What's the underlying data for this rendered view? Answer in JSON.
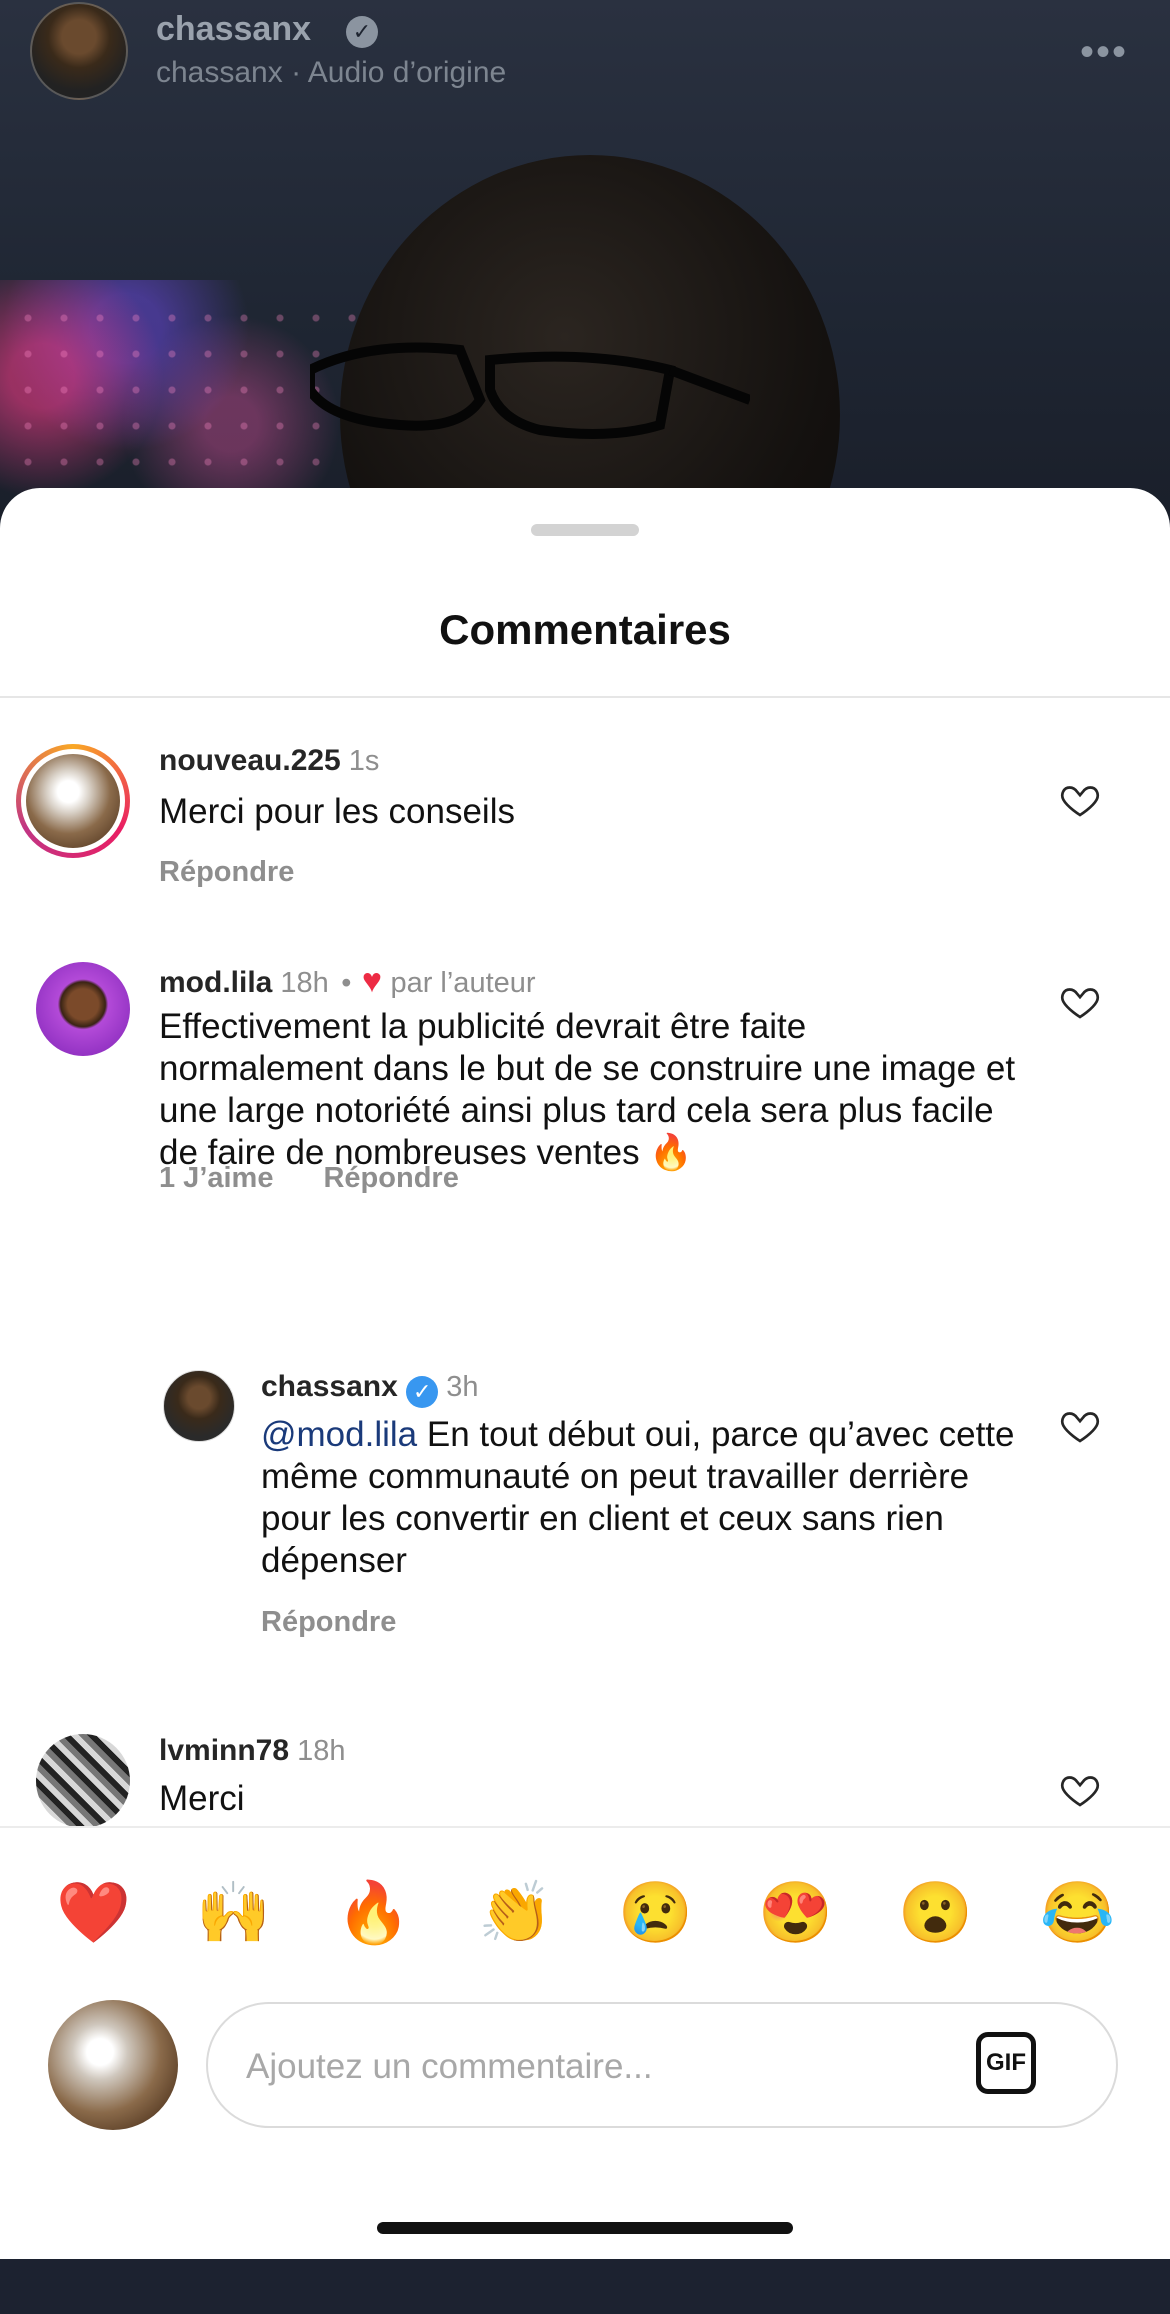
{
  "header": {
    "username": "chassanx",
    "subtitle": "chassanx · Audio d’origine",
    "more_icon": "more-horizontal-icon"
  },
  "sheet": {
    "title": "Commentaires"
  },
  "comments": [
    {
      "user": "nouveau.225",
      "time": "1s",
      "text": "Merci pour les conseils",
      "reply_label": "Répondre"
    },
    {
      "user": "mod.lila",
      "time": "18h",
      "author_like": "par l’auteur",
      "separator": "•",
      "text": "Effectivement la publicité devrait être faite normalement dans le but de se construire une image et une large notoriété ainsi plus tard cela sera plus facile de faire de nombreuses ventes 🔥",
      "likes_label": "1 J’aime",
      "reply_label": "Répondre"
    },
    {
      "user": "chassanx",
      "time": "3h",
      "mention": "@mod.lila",
      "text": "En tout début oui, parce qu’avec cette même communauté on peut travailler derrière pour les convertir en client et ceux sans rien dépenser",
      "reply_label": "Répondre"
    },
    {
      "user": "lvminn78",
      "time": "18h",
      "text": "Merci"
    }
  ],
  "emojis": [
    "❤️",
    "🙌",
    "🔥",
    "👏",
    "😢",
    "😍",
    "😮",
    "😂"
  ],
  "composer": {
    "placeholder": "Ajoutez un commentaire...",
    "gif_label": "GIF"
  }
}
